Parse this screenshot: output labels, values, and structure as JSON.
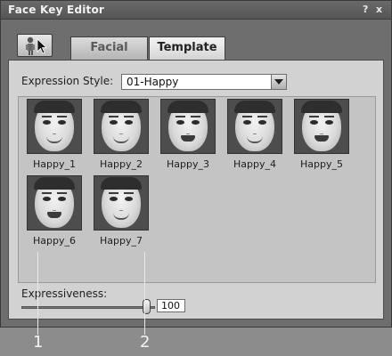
{
  "window": {
    "title": "Face Key Editor",
    "help_label": "?",
    "close_label": "x"
  },
  "toolbar": {
    "tool_icon": "character-cursor-icon"
  },
  "tabs": [
    {
      "label": "Facial",
      "active": false
    },
    {
      "label": "Template",
      "active": true
    }
  ],
  "expression_style": {
    "label": "Expression Style:",
    "value": "01-Happy"
  },
  "templates": [
    {
      "label": "Happy_1",
      "mouth": "smile"
    },
    {
      "label": "Happy_2",
      "mouth": "smile"
    },
    {
      "label": "Happy_3",
      "mouth": "open"
    },
    {
      "label": "Happy_4",
      "mouth": "smile"
    },
    {
      "label": "Happy_5",
      "mouth": "open"
    },
    {
      "label": "Happy_6",
      "mouth": "open"
    },
    {
      "label": "Happy_7",
      "mouth": "smile"
    }
  ],
  "expressiveness": {
    "label": "Expressiveness:",
    "value": "100",
    "level": 1.0
  },
  "callouts": [
    "1",
    "2"
  ],
  "colors": {
    "window_bg": "#6e6e6e",
    "panel_bg": "#d2d2d2",
    "active_tab": "#e6e6e6"
  }
}
